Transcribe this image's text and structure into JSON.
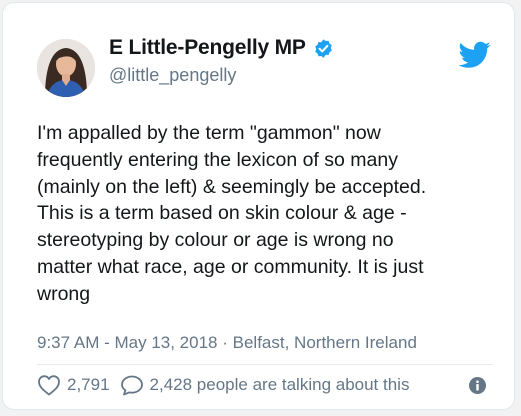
{
  "tweet": {
    "author_name": "E Little-Pengelly MP",
    "handle": "@little_pengelly",
    "text": "I'm appalled by the term \"gammon\" now\nfrequently entering the lexicon of so many\n(mainly on the left) & seemingly be accepted.\nThis is a term based on skin colour & age -\nstereotyping by colour or age is wrong no\nmatter what race, age or community. It is just\nwrong",
    "timestamp": "9:37 AM - May 13, 2018",
    "separator": "·",
    "location": "Belfast, Northern Ireland",
    "likes": "2,791",
    "replies_text": "2,428 people are talking about this"
  },
  "icons": {
    "verified": "verified-badge-icon",
    "brand": "twitter-bird-icon",
    "like": "heart-icon",
    "reply": "speech-bubble-icon",
    "info": "info-icon"
  },
  "colors": {
    "brand_blue": "#1da1f2",
    "text_primary": "#14171a",
    "text_secondary": "#657786"
  }
}
